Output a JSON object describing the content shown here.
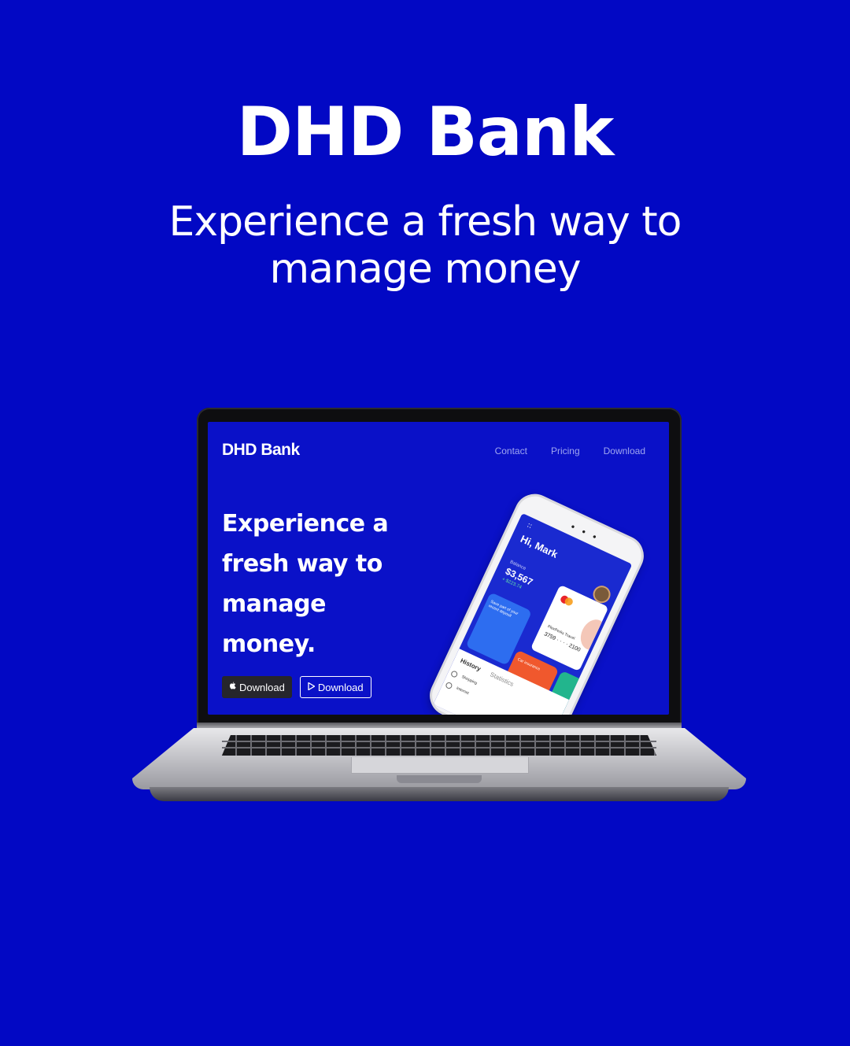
{
  "hero": {
    "title": "DHD Bank",
    "subtitle": "Experience a fresh way to manage money"
  },
  "site": {
    "brand": "DHD Bank",
    "nav": [
      "Contact",
      "Pricing",
      "Download"
    ],
    "headline": "Experience a fresh way to manage money.",
    "buttons": {
      "apple_download": "Download",
      "play_download": "Download"
    }
  },
  "phone": {
    "greeting": "Hi, Mark",
    "balance_label": "Balance",
    "balance": "$3,567",
    "balance_change": "+ $223.74",
    "card_name": "PlexPerks Travel",
    "card_number": "3759 · · · · 2100",
    "tiles": [
      "Save part of your recent deposit",
      "Car insurance"
    ],
    "tabs": [
      "History",
      "Statistics"
    ],
    "list": [
      "Shopping",
      "Internet"
    ]
  },
  "colors": {
    "background": "#0208c4",
    "screen": "#0a11c8",
    "nav_link": "#9fa6f0"
  },
  "icons": [
    "apple-icon",
    "play-icon"
  ]
}
